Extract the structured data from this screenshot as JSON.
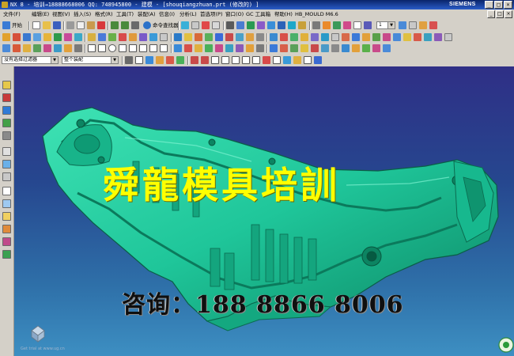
{
  "window": {
    "title": "NX 8 - 培训→18888668006 QQ: 748945800 - 建模 - [shouqiangzhuan.prt (修改的) ]",
    "brand": "SIEMENS",
    "buttons": [
      "_",
      "□",
      "×"
    ]
  },
  "menu": {
    "items": [
      "文件(F)",
      "编辑(E)",
      "视图(V)",
      "插入(S)",
      "格式(R)",
      "工具(T)",
      "装配(A)",
      "信息(I)",
      "分析(L)",
      "首选项(P)",
      "窗口(O)",
      "GC 工具箱",
      "帮助(H)",
      "HB_MOULD M6.6"
    ],
    "doc_buttons": [
      "_",
      "□",
      "×"
    ]
  },
  "toolbar1": {
    "start_label": "开始",
    "command_finder_label": "命令查找器",
    "layer_value": "1"
  },
  "selection": {
    "filter_value": "没有选择过滤器",
    "scope_value": "整个装配"
  },
  "overlay": {
    "title": "舜龍模具培訓",
    "contact": "咨询：188 8866 8006"
  },
  "status_text": "Get trial at www.ug.cn",
  "colors": {
    "part": "#1fc69a",
    "part_dark": "#0b7a5c",
    "title_text": "#ffff00",
    "titlebar": "#0a246a",
    "chrome": "#d4d0c8"
  }
}
